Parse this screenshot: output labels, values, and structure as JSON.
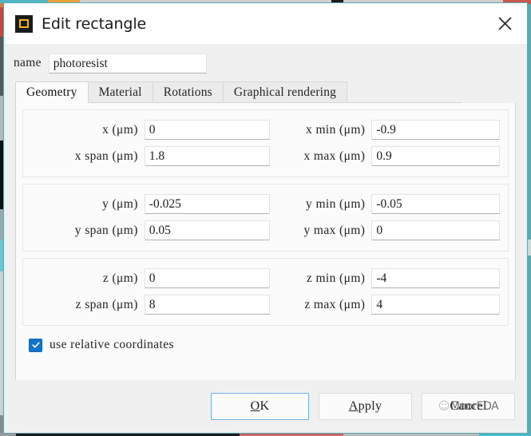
{
  "window": {
    "title": "Edit rectangle",
    "icon": "rectangle-object-icon",
    "close_icon": "close-icon",
    "accent": "#5fa8ad"
  },
  "name_field": {
    "label": "name",
    "value": "photoresist",
    "placeholder": ""
  },
  "tabs": [
    {
      "label": "Geometry",
      "active": true
    },
    {
      "label": "Material",
      "active": false
    },
    {
      "label": "Rotations",
      "active": false
    },
    {
      "label": "Graphical rendering",
      "active": false
    }
  ],
  "geometry": {
    "x_group": {
      "center_label": "x (μm)",
      "center_value": "0",
      "min_label": "x min (μm)",
      "min_value": "-0.9",
      "span_label": "x span (μm)",
      "span_value": "1.8",
      "max_label": "x max (μm)",
      "max_value": "0.9"
    },
    "y_group": {
      "center_label": "y (μm)",
      "center_value": "-0.025",
      "min_label": "y min (μm)",
      "min_value": "-0.05",
      "span_label": "y span (μm)",
      "span_value": "0.05",
      "max_label": "y max (μm)",
      "max_value": "0"
    },
    "z_group": {
      "center_label": "z (μm)",
      "center_value": "0",
      "min_label": "z min (μm)",
      "min_value": "-4",
      "span_label": "z span (μm)",
      "span_value": "8",
      "max_label": "z max (μm)",
      "max_value": "4"
    }
  },
  "relative_coordinates": {
    "label": "use relative coordinates",
    "checked": true,
    "check_color": "#1573c6"
  },
  "buttons": {
    "ok": "OK",
    "apply": "Apply",
    "cancel": "Cancel"
  },
  "watermark": {
    "text": "MoorEDA",
    "icon": "wechat-icon"
  }
}
